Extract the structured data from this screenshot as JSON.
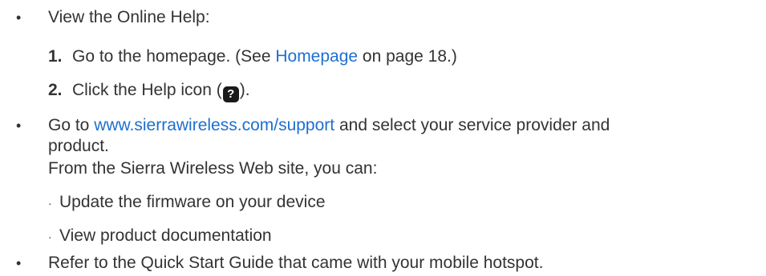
{
  "bullet_char": "•",
  "subbullet_char": "·",
  "items": [
    {
      "text": "View the Online Help:",
      "steps": [
        {
          "num": "1.",
          "pre": "Go to the homepage. (See ",
          "link": "Homepage",
          "post": " on page 18.)"
        },
        {
          "num": "2.",
          "pre": "Click the Help icon (",
          "icon_glyph": "?",
          "icon_name": "help-icon",
          "post": ")."
        }
      ]
    },
    {
      "pre": "Go to ",
      "link": "www.sierrawireless.com/support",
      "post": " and select your service provider and",
      "cont": "product.",
      "intro": "From the Sierra Wireless Web site, you can:",
      "subitems": [
        "Update the firmware on your device",
        "View product documentation"
      ]
    },
    {
      "text": "Refer to the Quick Start Guide that came with your mobile hotspot."
    }
  ]
}
